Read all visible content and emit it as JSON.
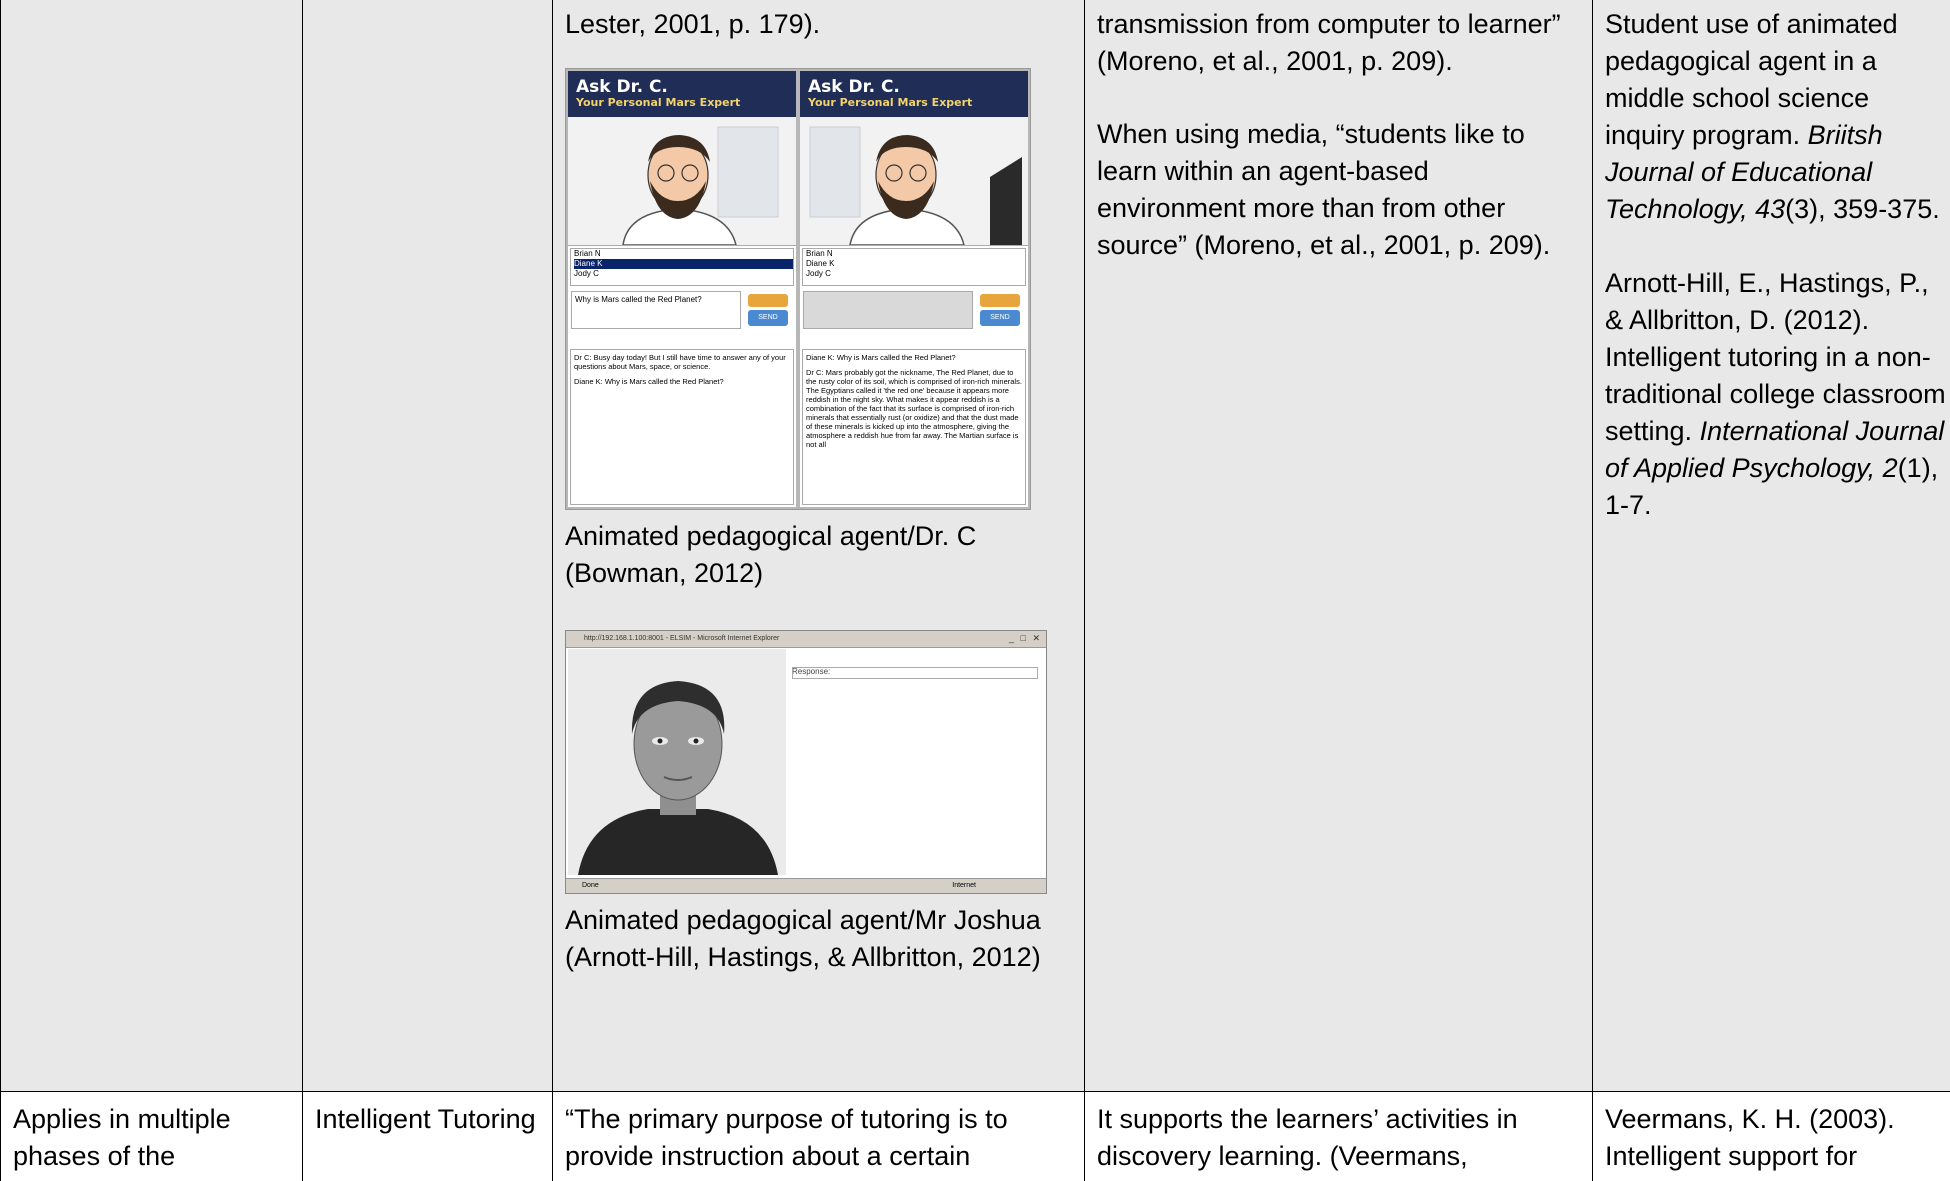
{
  "rows": [
    {
      "col1": "",
      "col2": "",
      "col3": {
        "intro": "Lester, 2001, p. 179).",
        "figure1": {
          "panel_title": "Ask Dr. C.",
          "panel_subtitle": "Your Personal Mars Expert",
          "names": [
            "Brian N",
            "Diane K",
            "Jody C"
          ],
          "question": "Why is Mars called the Red Planet?",
          "send_label": "SEND",
          "left_convo_1": "Dr C: Busy day today! But I still have time to answer any of your questions about Mars, space, or science.",
          "left_convo_2": "Diane K: Why is Mars called the Red Planet?",
          "right_convo_1": "Diane K: Why is Mars called the Red Planet?",
          "right_convo_2": "Dr C: Mars probably got the nickname, The Red Planet, due to the rusty color of its soil, which is comprised of iron-rich minerals. The Egyptians called it 'the red one' because it appears more reddish in the night sky. What makes it appear reddish is a combination of the fact that its surface is comprised of iron-rich minerals that essentially rust (or oxidize) and that the dust made of these minerals is kicked up into the atmosphere, giving the atmosphere a reddish hue from far away. The Martian surface is not all",
          "caption": "Animated pedagogical agent/Dr. C (Bowman, 2012)"
        },
        "figure2": {
          "title_bar": "http://192.168.1.100:8001 - ELSIM - Microsoft Internet Explorer",
          "response_label": "Response:",
          "status_left": "Done",
          "status_right": "Internet",
          "caption": "Animated pedagogical agent/Mr Joshua (Arnott-Hill, Hastings, & Allbritton, 2012)"
        }
      },
      "col4": {
        "p1": "transmission from computer to learner” (Moreno, et al., 2001, p. 209).",
        "p2": "When using media, “students like to learn within an agent-based environment more than from other source” (Moreno, et al., 2001, p. 209)."
      },
      "col5": {
        "ref1_plain": "Student use of animated pedagogical agent in a middle school science inquiry program. ",
        "ref1_journal": "Briitsh Journal of Educational Technology, 43",
        "ref1_tail": "(3), 359-375.",
        "ref2_plain": "Arnott-Hill, E., Hastings, P., & Allbritton, D. (2012). Intelligent tutoring in a non-traditional college classroom setting. ",
        "ref2_journal": "International Journal of Applied Psychology, 2",
        "ref2_tail": "(1), 1-7."
      }
    },
    {
      "col1": "Applies in multiple phases of the",
      "col2": "Intelligent Tutoring",
      "col3": "“The primary purpose of tutoring is to provide instruction about a certain",
      "col4": "It supports the learners’ activities in discovery learning. (Veermans,",
      "col5": "Veermans, K. H. (2003). Intelligent support for"
    }
  ]
}
